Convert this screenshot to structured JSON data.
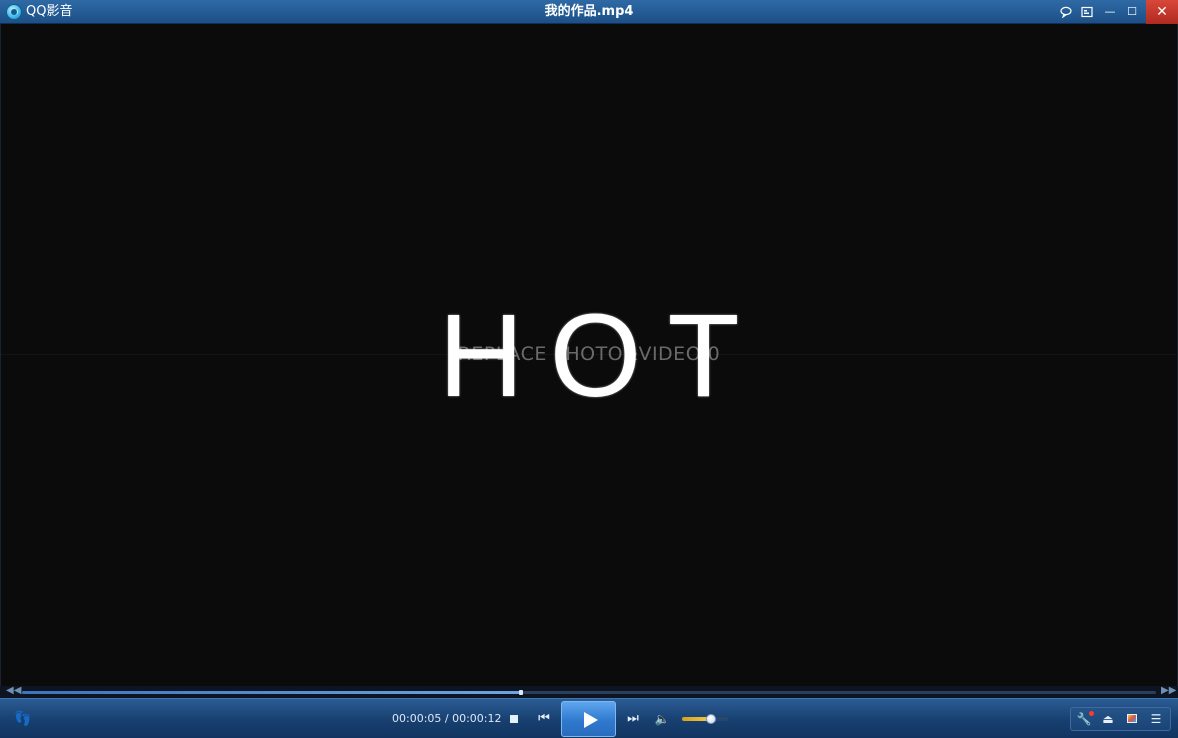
{
  "window": {
    "app_name": "QQ影音",
    "file_title": "我的作品.mp4",
    "buttons": {
      "feedback_icon": "speech-bubble-icon",
      "mini_mode_icon": "mini-mode-icon",
      "minimize_glyph": "—",
      "maximize_glyph": "☐",
      "close_glyph": "✕"
    }
  },
  "video": {
    "overlay_text": "REPLACE PHOTO&VIDEO 0",
    "main_text": "HOT"
  },
  "playback": {
    "progress": 0.44,
    "seek_back_glyph": "◀◀",
    "seek_forward_glyph": "▶▶",
    "time_display": "00:00:05 / 00:00:12",
    "volume": 0.62,
    "prev_glyph": "⏮",
    "next_glyph": "⏭",
    "volume_glyph": "🔈"
  },
  "toolbar": {
    "footprint_glyph": "👣",
    "tools_glyph": "🔧",
    "eject_glyph": "⏏",
    "list_glyph": "☰"
  },
  "colors": {
    "titlebar": "#2e6aa6",
    "close": "#c43a2e",
    "play_button": "#2f79cf",
    "volume_fill": "#f2c94a"
  }
}
